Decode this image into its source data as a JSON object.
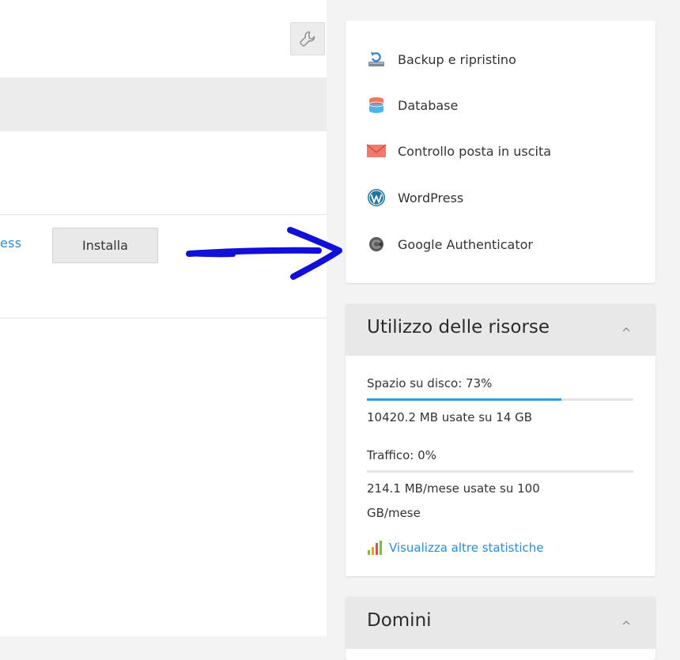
{
  "main": {
    "cut_link": "ess",
    "install_label": "Installa"
  },
  "tools": {
    "items": [
      {
        "label": "Backup e ripristino",
        "icon": "backup-icon"
      },
      {
        "label": "Database",
        "icon": "database-icon"
      },
      {
        "label": "Controllo posta in uscita",
        "icon": "mail-icon"
      },
      {
        "label": "WordPress",
        "icon": "wordpress-icon"
      },
      {
        "label": "Google Authenticator",
        "icon": "google-authenticator-icon"
      }
    ]
  },
  "resources": {
    "title": "Utilizzo delle risorse",
    "disk_label": "Spazio su disco: 73%",
    "disk_percent": 73,
    "disk_detail": "10420.2 MB usate su 14 GB",
    "traffic_label": "Traffico: 0%",
    "traffic_percent": 0,
    "traffic_detail_1": "214.1 MB/mese usate su 100",
    "traffic_detail_2": "GB/mese",
    "stats_link": "Visualizza altre statistiche"
  },
  "domains": {
    "title": "Domini"
  },
  "colors": {
    "link": "#2d8bd0",
    "progress": "#2e9ed8",
    "annotation_arrow": "#1010d8"
  }
}
